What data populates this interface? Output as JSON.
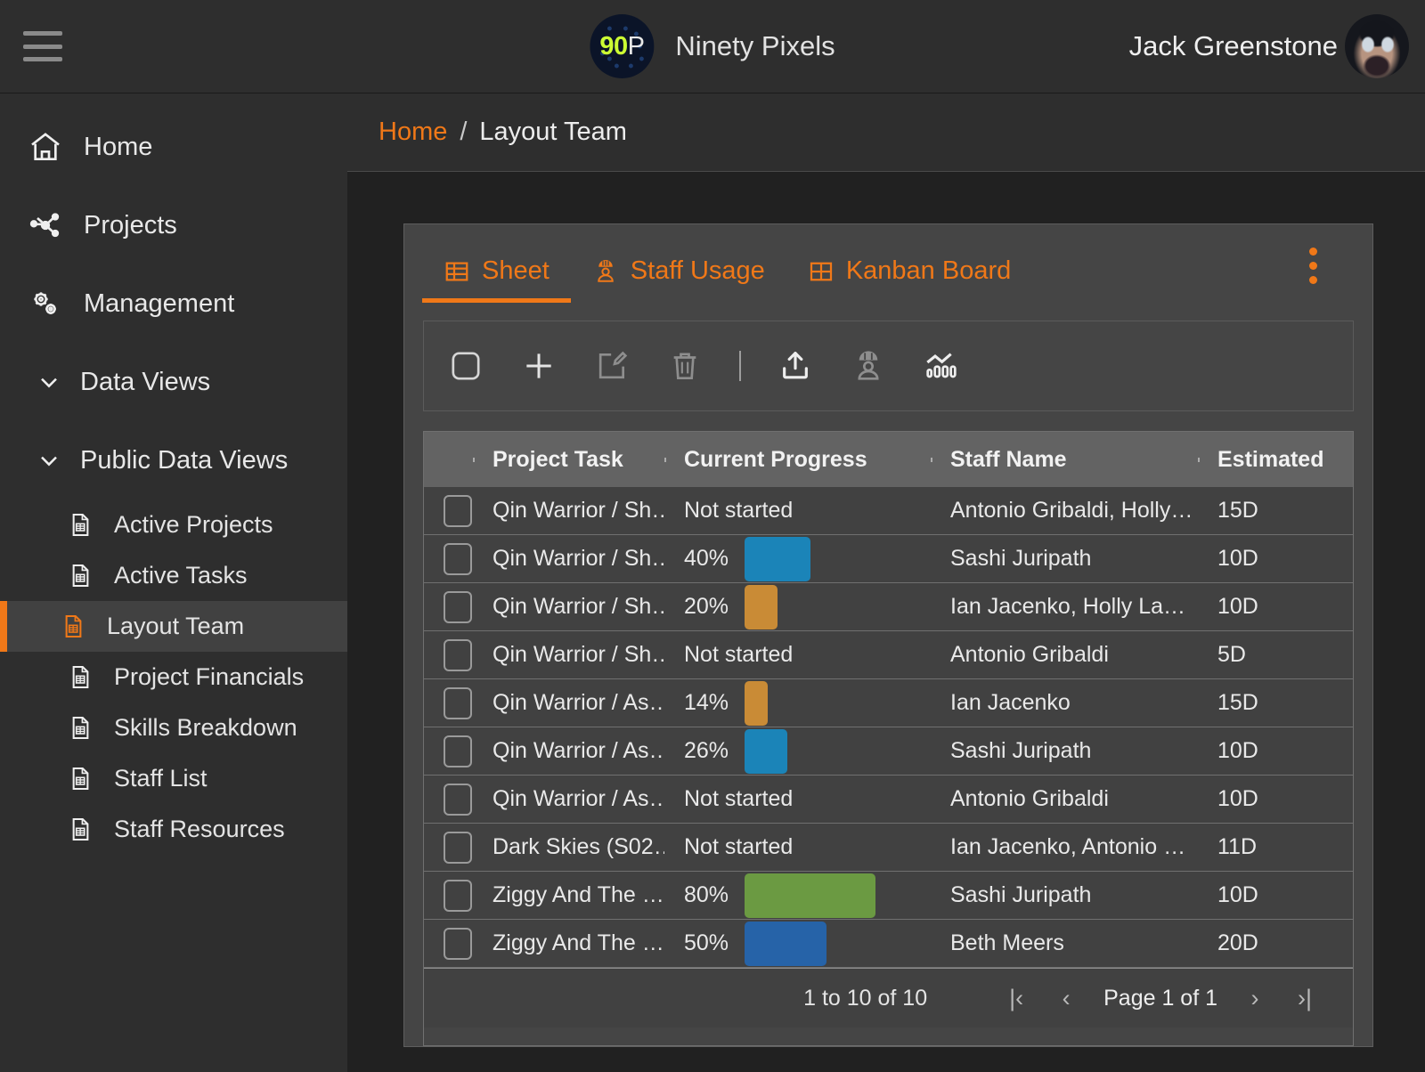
{
  "header": {
    "menu_icon": "hamburger-icon",
    "logo_number": "90",
    "logo_letter": "P",
    "brand_name": "Ninety Pixels",
    "user_name": "Jack Greenstone",
    "accent": "#f07818",
    "logo_green": "#ccff33"
  },
  "sidebar": {
    "items": [
      {
        "label": "Home",
        "icon": "home-icon"
      },
      {
        "label": "Projects",
        "icon": "projects-network-icon"
      },
      {
        "label": "Management",
        "icon": "gears-icon"
      }
    ],
    "groups": [
      {
        "label": "Data Views",
        "icon": "chevron-down-icon",
        "expanded": true
      },
      {
        "label": "Public Data Views",
        "icon": "chevron-down-icon",
        "expanded": true
      }
    ],
    "subitems": [
      {
        "label": "Active Projects",
        "icon": "sheet-icon",
        "active": false
      },
      {
        "label": "Active Tasks",
        "icon": "sheet-icon",
        "active": false
      },
      {
        "label": "Layout Team",
        "icon": "sheet-icon",
        "active": true
      },
      {
        "label": "Project Financials",
        "icon": "sheet-icon",
        "active": false
      },
      {
        "label": "Skills Breakdown",
        "icon": "sheet-icon",
        "active": false
      },
      {
        "label": "Staff List",
        "icon": "sheet-icon",
        "active": false
      },
      {
        "label": "Staff Resources",
        "icon": "sheet-icon",
        "active": false
      }
    ]
  },
  "breadcrumb": {
    "home": "Home",
    "separator": "/",
    "current": "Layout Team"
  },
  "tabs": [
    {
      "label": "Sheet",
      "icon": "table-icon",
      "active": true
    },
    {
      "label": "Staff Usage",
      "icon": "hardhat-person-icon",
      "active": false
    },
    {
      "label": "Kanban Board",
      "icon": "kanban-grid-icon",
      "active": false
    }
  ],
  "toolbar": {
    "buttons": [
      {
        "name": "select-all-checkbox",
        "icon": "checkbox-icon",
        "enabled": true
      },
      {
        "name": "add-row-button",
        "icon": "plus-icon",
        "enabled": true
      },
      {
        "name": "edit-row-button",
        "icon": "edit-pencil-icon",
        "enabled": false
      },
      {
        "name": "delete-row-button",
        "icon": "trash-icon",
        "enabled": false
      },
      {
        "name": "toolbar-divider",
        "icon": "divider",
        "enabled": false
      },
      {
        "name": "export-button",
        "icon": "upload-tray-icon",
        "enabled": true
      },
      {
        "name": "assign-staff-button",
        "icon": "hardhat-person-icon",
        "enabled": false
      },
      {
        "name": "chart-button",
        "icon": "chart-line-bars-icon",
        "enabled": true
      }
    ]
  },
  "table": {
    "columns": [
      "Project Task",
      "Current Progress",
      "Staff Name",
      "Estimated"
    ],
    "rows": [
      {
        "task": "Qin Warrior / Sh…",
        "progress_label": "Not started",
        "percent": null,
        "bar_color": null,
        "staff": "Antonio Gribaldi, Holly…",
        "estimated": "15D"
      },
      {
        "task": "Qin Warrior / Sh…",
        "progress_label": "40%",
        "percent": 40,
        "bar_color": "#1b84b8",
        "staff": "Sashi Juripath",
        "estimated": "10D"
      },
      {
        "task": "Qin Warrior / Sh…",
        "progress_label": "20%",
        "percent": 20,
        "bar_color": "#c98b36",
        "staff": "Ian Jacenko, Holly La…",
        "estimated": "10D"
      },
      {
        "task": "Qin Warrior / Sh…",
        "progress_label": "Not started",
        "percent": null,
        "bar_color": null,
        "staff": "Antonio Gribaldi",
        "estimated": "5D"
      },
      {
        "task": "Qin Warrior / As…",
        "progress_label": "14%",
        "percent": 14,
        "bar_color": "#c98b36",
        "staff": "Ian Jacenko",
        "estimated": "15D"
      },
      {
        "task": "Qin Warrior / As…",
        "progress_label": "26%",
        "percent": 26,
        "bar_color": "#1b84b8",
        "staff": "Sashi Juripath",
        "estimated": "10D"
      },
      {
        "task": "Qin Warrior / As…",
        "progress_label": "Not started",
        "percent": null,
        "bar_color": null,
        "staff": "Antonio Gribaldi",
        "estimated": "10D"
      },
      {
        "task": "Dark Skies (S02…",
        "progress_label": "Not started",
        "percent": null,
        "bar_color": null,
        "staff": "Ian Jacenko, Antonio …",
        "estimated": "11D"
      },
      {
        "task": "Ziggy And The …",
        "progress_label": "80%",
        "percent": 80,
        "bar_color": "#6b9a42",
        "staff": "Sashi Juripath",
        "estimated": "10D"
      },
      {
        "task": "Ziggy And The …",
        "progress_label": "50%",
        "percent": 50,
        "bar_color": "#2663a8",
        "staff": "Beth Meers",
        "estimated": "20D"
      }
    ]
  },
  "pagination": {
    "count_text": "1 to 10 of 10",
    "first": "|‹",
    "prev": "‹",
    "page_label": "Page 1 of 1",
    "next": "›",
    "last": "›|"
  }
}
